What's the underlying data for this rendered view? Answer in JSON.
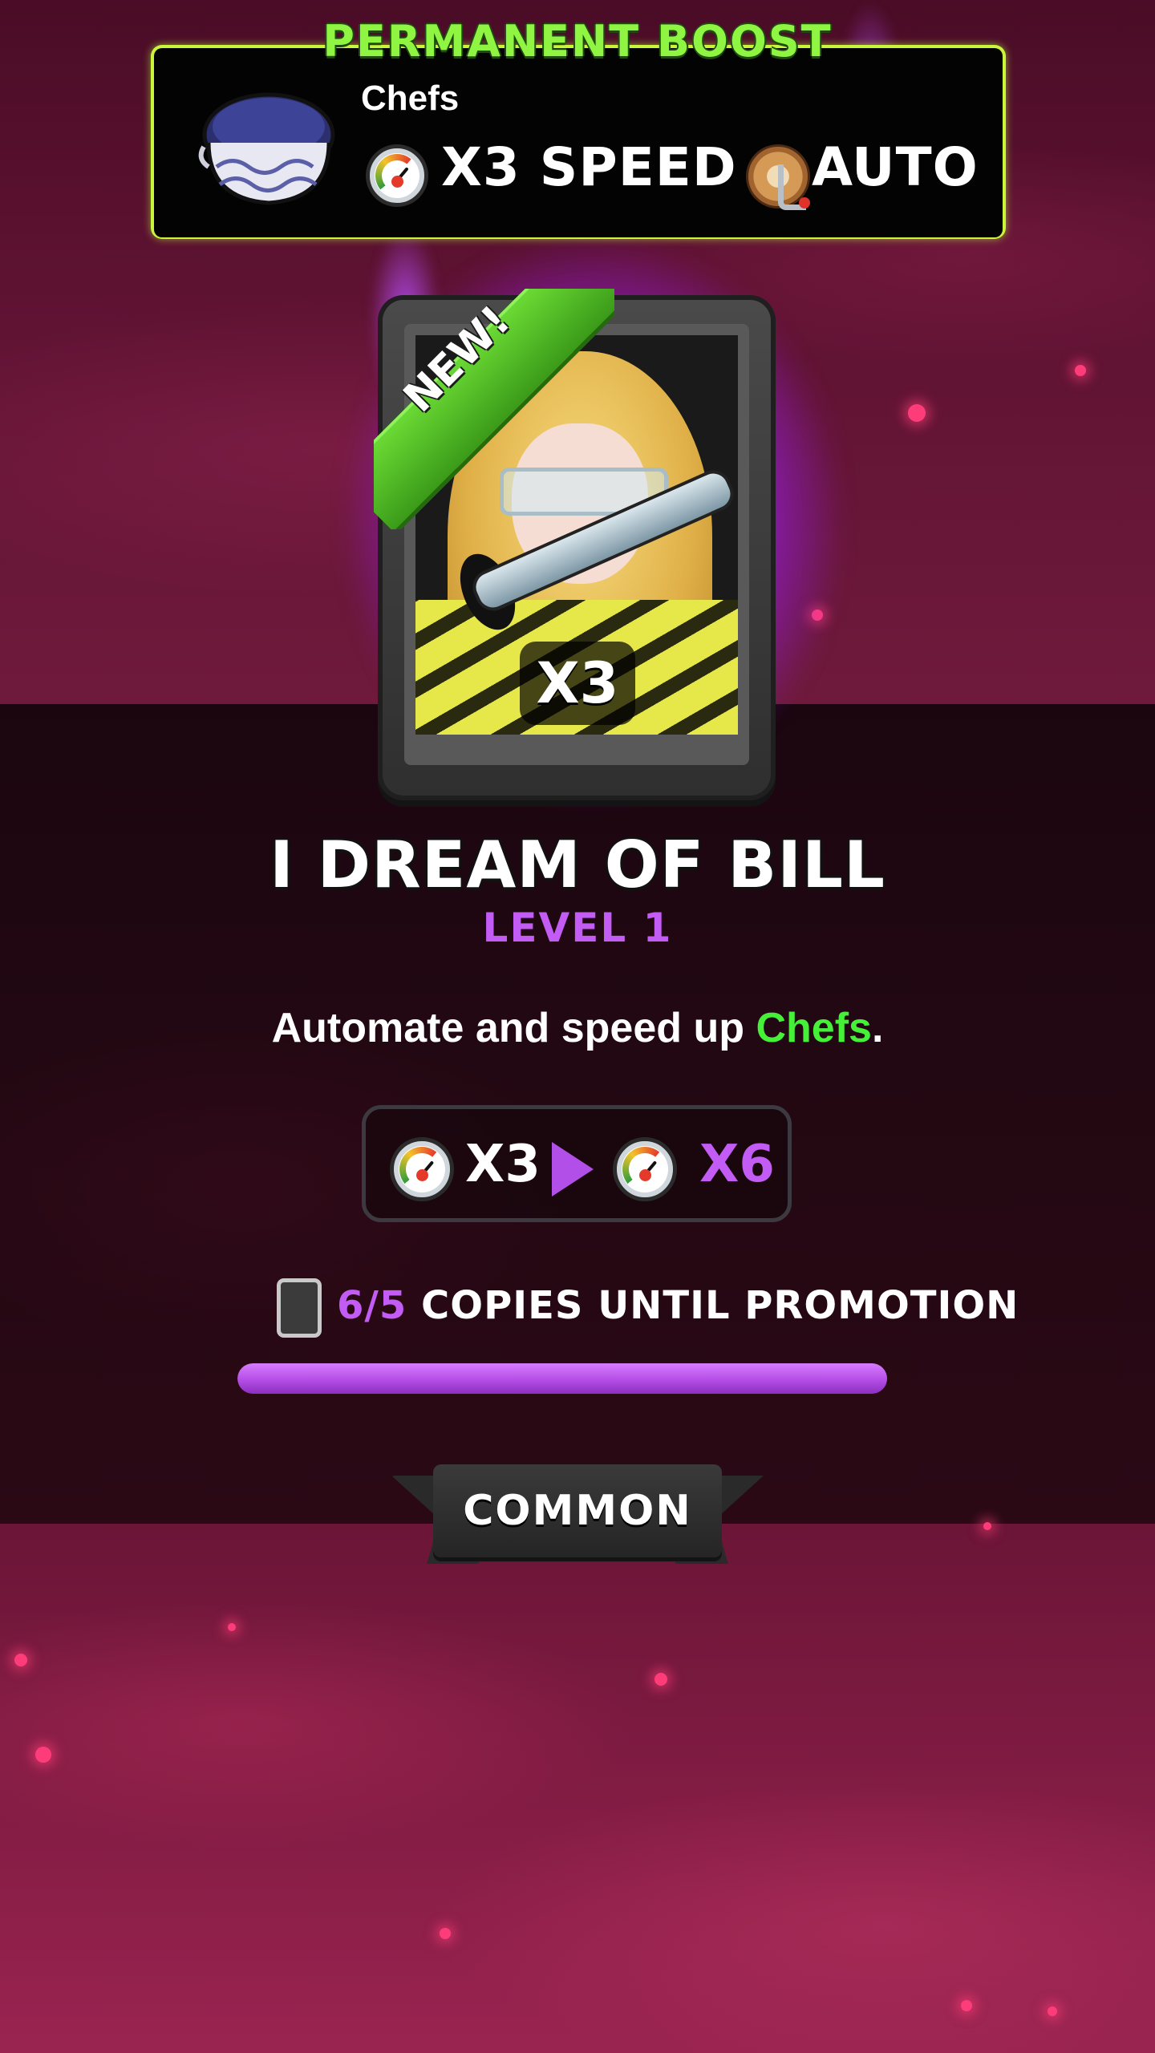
{
  "boost": {
    "title": "PERMANENT BOOST",
    "subject": "Chefs",
    "speed_label": "X3 SPEED +",
    "auto_label": "AUTO",
    "icons": [
      "pot-icon",
      "speed-gauge-icon",
      "cog-crank-icon"
    ]
  },
  "card": {
    "new_label": "NEW!",
    "multiplier": "X3",
    "name": "I DREAM OF BILL",
    "level": "LEVEL 1"
  },
  "description": {
    "prefix": "Automate and speed up ",
    "highlight": "Chefs",
    "suffix": "."
  },
  "upgrade": {
    "current": "X3",
    "next": "X6"
  },
  "progress": {
    "count": "6/5",
    "label": "COPIES UNTIL PROMOTION",
    "fill_fraction": 1.0
  },
  "rarity": "COMMON",
  "colors": {
    "accent_green": "#8ff542",
    "highlight_green": "#46f039",
    "level_purple": "#c25cf5",
    "glow_purple": "#b03cff",
    "background": "#6e1536"
  }
}
